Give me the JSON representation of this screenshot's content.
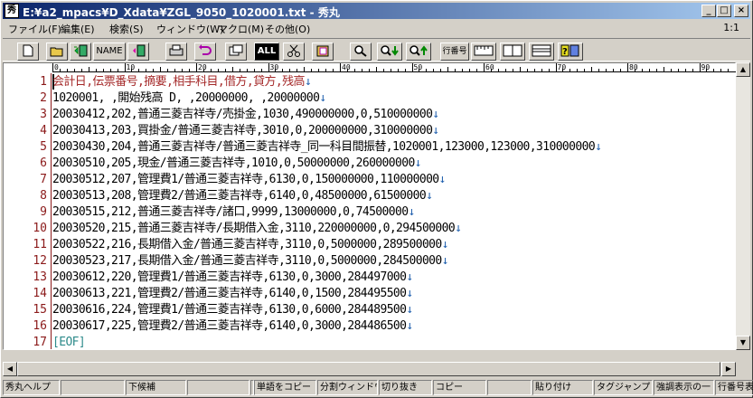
{
  "window": {
    "title": "E:¥a2_mpacs¥D_Xdata¥ZGL_9050_1020001.txt - 秀丸",
    "app_icon": "秀"
  },
  "menubar": {
    "items": [
      "ファイル(F)",
      "編集(E)",
      "検索(S)",
      "ウィンドウ(W)",
      "マクロ(M)",
      "その他(O)"
    ],
    "position": "1:1"
  },
  "toolbar": {
    "name_label": "NAME",
    "all_label": "ALL",
    "linenum_label": "行番号"
  },
  "ruler": {
    "marks": [
      "0",
      "10",
      "20",
      "30",
      "40",
      "50",
      "60",
      "70",
      "80",
      "90"
    ]
  },
  "editor": {
    "eol_mark": "↓",
    "lines": [
      {
        "num": "1",
        "text": "会計日,伝票番号,摘要,相手科目,借方,貸方,残高"
      },
      {
        "num": "2",
        "text": "1020001, ,開始残高 D, ,20000000, ,20000000"
      },
      {
        "num": "3",
        "text": "20030412,202,普通三菱吉祥寺/売掛金,1030,490000000,0,510000000"
      },
      {
        "num": "4",
        "text": "20030413,203,買掛金/普通三菱吉祥寺,3010,0,200000000,310000000"
      },
      {
        "num": "5",
        "text": "20030430,204,普通三菱吉祥寺/普通三菱吉祥寺_同一科目間振替,1020001,123000,123000,310000000"
      },
      {
        "num": "6",
        "text": "20030510,205,現金/普通三菱吉祥寺,1010,0,50000000,260000000"
      },
      {
        "num": "7",
        "text": "20030512,207,管理費1/普通三菱吉祥寺,6130,0,150000000,110000000"
      },
      {
        "num": "8",
        "text": "20030513,208,管理費2/普通三菱吉祥寺,6140,0,48500000,61500000"
      },
      {
        "num": "9",
        "text": "20030515,212,普通三菱吉祥寺/諸口,9999,13000000,0,74500000"
      },
      {
        "num": "10",
        "text": "20030520,215,普通三菱吉祥寺/長期借入金,3110,220000000,0,294500000"
      },
      {
        "num": "11",
        "text": "20030522,216,長期借入金/普通三菱吉祥寺,3110,0,5000000,289500000"
      },
      {
        "num": "12",
        "text": "20030523,217,長期借入金/普通三菱吉祥寺,3110,0,5000000,284500000"
      },
      {
        "num": "13",
        "text": "20030612,220,管理費1/普通三菱吉祥寺,6130,0,3000,284497000"
      },
      {
        "num": "14",
        "text": "20030613,221,管理費2/普通三菱吉祥寺,6140,0,1500,284495500"
      },
      {
        "num": "15",
        "text": "20030616,224,管理費1/普通三菱吉祥寺,6130,0,6000,284489500"
      },
      {
        "num": "16",
        "text": "20030617,225,管理費2/普通三菱吉祥寺,6140,0,3000,284486500"
      },
      {
        "num": "17",
        "text": "[EOF]"
      }
    ]
  },
  "statusbar": {
    "cells": [
      "秀丸ヘルプ",
      "",
      "下候補",
      "",
      "",
      "単語をコピー",
      "分割ウィンドウ",
      "切り抜き",
      "コピー",
      "",
      "貼り付け",
      "タグジャンプ",
      "強調表示の一",
      "行番号表示/"
    ]
  },
  "colors": {
    "title_start": "#0a246a",
    "title_end": "#a6caf0",
    "header_text": "#a52a2a",
    "eol_mark": "#1f5fae",
    "line_number": "#8b1a1a",
    "eof": "#2e8b8b"
  }
}
